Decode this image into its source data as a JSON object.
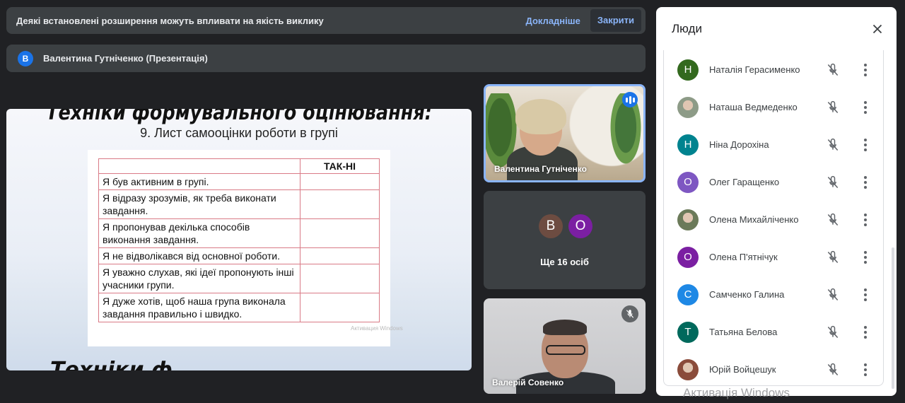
{
  "banner": {
    "message": "Деякі встановлені розширення можуть впливати на якість виклику",
    "details_label": "Докладніше",
    "close_label": "Закрити"
  },
  "presenter": {
    "initial": "В",
    "label": "Валентина Гутніченко (Презентація)"
  },
  "slide": {
    "title": "Техніки формувального оцінювання:",
    "subtitle": "9. Лист самооцінки роботи в групі",
    "column_header": "ТАК-НІ",
    "rows": [
      "Я був активним в групі.",
      "Я відразу зрозумів, як треба виконати завдання.",
      "Я пропонував декілька способів виконання завдання.",
      "Я не відволікався від основної роботи.",
      "Я уважно слухав, які ідеї пропонують інші учасники групи.",
      "Я дуже хотів, щоб наша група виконала завдання правильно і швидко."
    ],
    "bottom_text": "Техніки ф",
    "watermark": "Активация Windows"
  },
  "tiles": {
    "main_speaker": "Валентина Гутніченко",
    "more_label": "Ще 16 осіб",
    "more_avatars": [
      {
        "initial": "В",
        "color": "#6d4c41"
      },
      {
        "initial": "О",
        "color": "#7b1fa2"
      }
    ],
    "second_speaker": "Валерій Совенко"
  },
  "panel": {
    "title": "Люди",
    "people": [
      {
        "name": "Наталія Герасименко",
        "initial": "Н",
        "color": "#33691e",
        "photo": false
      },
      {
        "name": "Наташа Ведмеденко",
        "initial": "",
        "color": "#8d9b87",
        "photo": true
      },
      {
        "name": "Ніна Дорохіна",
        "initial": "Н",
        "color": "#00838f",
        "photo": false
      },
      {
        "name": "Олег Гаращенко",
        "initial": "О",
        "color": "#7e57c2",
        "photo": false
      },
      {
        "name": "Олена Михайліченко",
        "initial": "",
        "color": "#6b7a59",
        "photo": true
      },
      {
        "name": "Олена П'ятнічук",
        "initial": "О",
        "color": "#7b1fa2",
        "photo": false
      },
      {
        "name": "Самченко Галина",
        "initial": "С",
        "color": "#1e88e5",
        "photo": false
      },
      {
        "name": "Татьяна Белова",
        "initial": "Т",
        "color": "#00695c",
        "photo": false
      },
      {
        "name": "Юрій Войцешук",
        "initial": "",
        "color": "#8a4b3a",
        "photo": true
      }
    ]
  },
  "os_watermark": "Активація Windows",
  "colors": {
    "background": "#202124",
    "bar": "#3c4043",
    "link": "#8ab4f8",
    "accent": "#1a73e8"
  }
}
